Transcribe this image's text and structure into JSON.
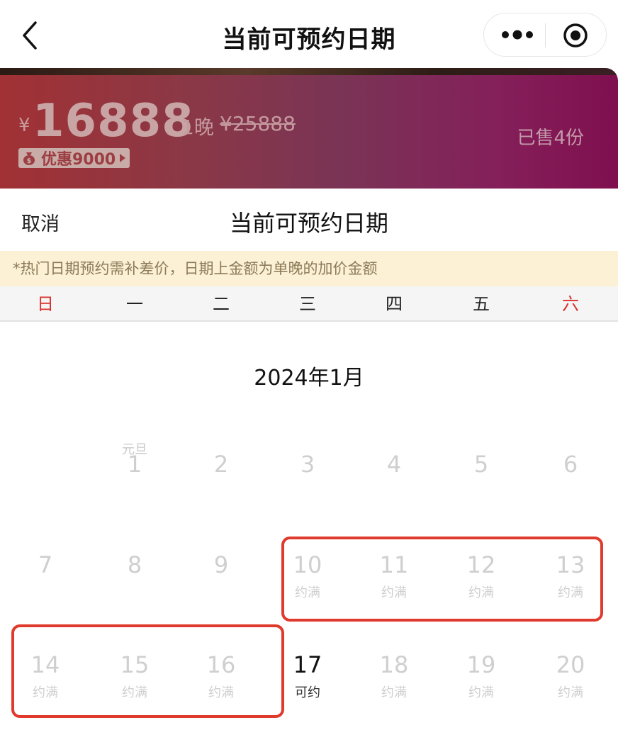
{
  "nav": {
    "title": "当前可预约日期",
    "back_icon": "chevron-left-icon",
    "more_icon": "more-dots-icon",
    "target_icon": "target-circle-icon"
  },
  "banner": {
    "currency": "¥",
    "price": "16888",
    "unit": "1晚",
    "original_price": "¥25888",
    "discount_label": "优惠9000",
    "sold": "已售4份",
    "colors": {
      "start": "#a13134",
      "end": "#7f0f4e"
    }
  },
  "sheet": {
    "cancel_label": "取消",
    "title": "当前可预约日期",
    "notice": "*热门日期预约需补差价，日期上金额为单晚的加价金额"
  },
  "weekdays": [
    "日",
    "一",
    "二",
    "三",
    "四",
    "五",
    "六"
  ],
  "calendar": {
    "month_title": "2024年1月",
    "days": [
      {
        "day": "1",
        "holiday": "元旦",
        "status": ""
      },
      {
        "day": "2",
        "holiday": "",
        "status": ""
      },
      {
        "day": "3",
        "holiday": "",
        "status": ""
      },
      {
        "day": "4",
        "holiday": "",
        "status": ""
      },
      {
        "day": "5",
        "holiday": "",
        "status": ""
      },
      {
        "day": "6",
        "holiday": "",
        "status": ""
      },
      {
        "day": "7",
        "holiday": "",
        "status": ""
      },
      {
        "day": "8",
        "holiday": "",
        "status": ""
      },
      {
        "day": "9",
        "holiday": "",
        "status": ""
      },
      {
        "day": "10",
        "holiday": "",
        "status": "约满"
      },
      {
        "day": "11",
        "holiday": "",
        "status": "约满"
      },
      {
        "day": "12",
        "holiday": "",
        "status": "约满"
      },
      {
        "day": "13",
        "holiday": "",
        "status": "约满"
      },
      {
        "day": "14",
        "holiday": "",
        "status": "约满"
      },
      {
        "day": "15",
        "holiday": "",
        "status": "约满"
      },
      {
        "day": "16",
        "holiday": "",
        "status": "约满"
      },
      {
        "day": "17",
        "holiday": "",
        "status": "可约"
      },
      {
        "day": "18",
        "holiday": "",
        "status": "约满"
      },
      {
        "day": "19",
        "holiday": "",
        "status": "约满"
      },
      {
        "day": "20",
        "holiday": "",
        "status": "约满"
      }
    ],
    "highlight_color": "#e03a2c"
  }
}
